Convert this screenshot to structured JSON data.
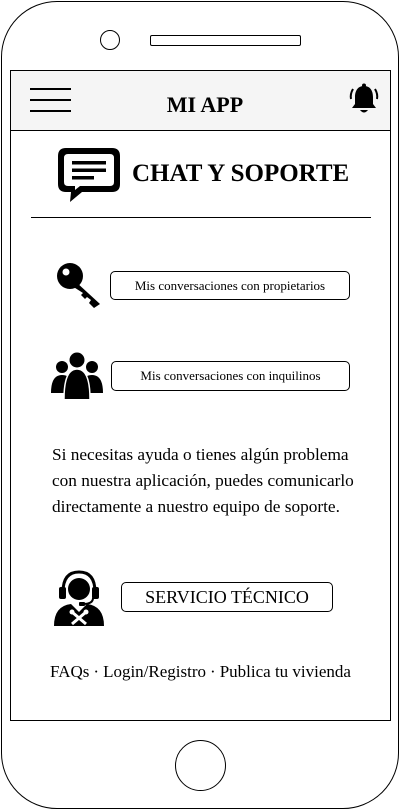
{
  "header": {
    "title": "MI APP",
    "menu_icon": "hamburger-menu-icon",
    "notification_icon": "bell-icon"
  },
  "section": {
    "icon": "chat-bubble-icon",
    "title": "CHAT Y SOPORTE"
  },
  "conversations": [
    {
      "icon": "key-icon",
      "label": "Mis conversaciones con propietarios"
    },
    {
      "icon": "users-group-icon",
      "label": "Mis conversaciones con inquilinos"
    }
  ],
  "help": {
    "text": "Si necesitas ayuda o tienes algún problema con nuestra aplicación, puedes comunicarlo directamente a nuestro equipo de soporte."
  },
  "support": {
    "icon": "support-agent-icon",
    "button_label": "SERVICIO TÉCNICO"
  },
  "footer": {
    "links": [
      "FAQs",
      "Login/Registro",
      "Publica tu vivienda"
    ],
    "separator": "·"
  }
}
